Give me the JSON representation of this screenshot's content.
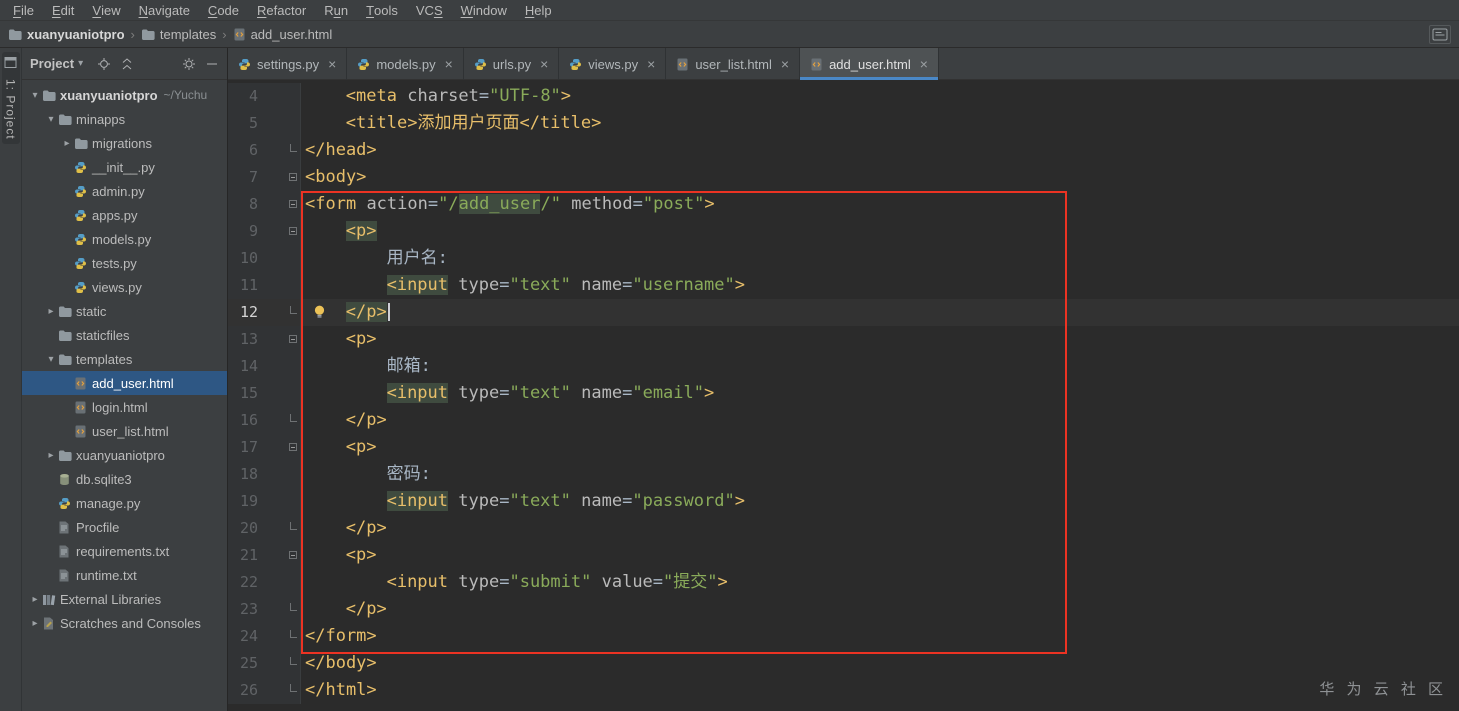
{
  "colors": {
    "accent_blue": "#4a88c7",
    "annotation_red": "#ec3323",
    "tag_yellow": "#e8bf6a",
    "string_green": "#8aab5a",
    "selection_blue": "#2e5784",
    "panel_bg": "#3c3f41",
    "editor_bg": "#2b2b2b",
    "current_line_bg": "#323232"
  },
  "menu": {
    "items": [
      {
        "label": "File",
        "mnemonic": 0
      },
      {
        "label": "Edit",
        "mnemonic": 0
      },
      {
        "label": "View",
        "mnemonic": 0
      },
      {
        "label": "Navigate",
        "mnemonic": 0
      },
      {
        "label": "Code",
        "mnemonic": 0
      },
      {
        "label": "Refactor",
        "mnemonic": 0
      },
      {
        "label": "Run",
        "mnemonic": 1
      },
      {
        "label": "Tools",
        "mnemonic": 0
      },
      {
        "label": "VCS",
        "mnemonic": 2
      },
      {
        "label": "Window",
        "mnemonic": 0
      },
      {
        "label": "Help",
        "mnemonic": 0
      }
    ]
  },
  "breadcrumb": {
    "items": [
      {
        "label": "xuanyuaniotpro",
        "icon": "folder"
      },
      {
        "label": "templates",
        "icon": "folder"
      },
      {
        "label": "add_user.html",
        "icon": "html"
      }
    ]
  },
  "stripe": {
    "label": "1: Project"
  },
  "project_panel": {
    "title": "Project",
    "tree": [
      {
        "label": "xuanyuaniotpro",
        "suffix": "~/Yuchu",
        "depth": 0,
        "icon": "folder",
        "arrow": "down",
        "bold": true
      },
      {
        "label": "minapps",
        "depth": 1,
        "icon": "folder",
        "arrow": "down"
      },
      {
        "label": "migrations",
        "depth": 2,
        "icon": "folder",
        "arrow": "right"
      },
      {
        "label": "__init__.py",
        "depth": 2,
        "icon": "python"
      },
      {
        "label": "admin.py",
        "depth": 2,
        "icon": "python"
      },
      {
        "label": "apps.py",
        "depth": 2,
        "icon": "python"
      },
      {
        "label": "models.py",
        "depth": 2,
        "icon": "python"
      },
      {
        "label": "tests.py",
        "depth": 2,
        "icon": "python"
      },
      {
        "label": "views.py",
        "depth": 2,
        "icon": "python"
      },
      {
        "label": "static",
        "depth": 1,
        "icon": "folder",
        "arrow": "right"
      },
      {
        "label": "staticfiles",
        "depth": 1,
        "icon": "folder"
      },
      {
        "label": "templates",
        "depth": 1,
        "icon": "folder",
        "arrow": "down"
      },
      {
        "label": "add_user.html",
        "depth": 2,
        "icon": "html",
        "selected": true
      },
      {
        "label": "login.html",
        "depth": 2,
        "icon": "html"
      },
      {
        "label": "user_list.html",
        "depth": 2,
        "icon": "html"
      },
      {
        "label": "xuanyuaniotpro",
        "depth": 1,
        "icon": "folder",
        "arrow": "right"
      },
      {
        "label": "db.sqlite3",
        "depth": 1,
        "icon": "db"
      },
      {
        "label": "manage.py",
        "depth": 1,
        "icon": "python"
      },
      {
        "label": "Procfile",
        "depth": 1,
        "icon": "text"
      },
      {
        "label": "requirements.txt",
        "depth": 1,
        "icon": "text"
      },
      {
        "label": "runtime.txt",
        "depth": 1,
        "icon": "text"
      },
      {
        "label": "External Libraries",
        "depth": 0,
        "icon": "lib",
        "arrow": "right"
      },
      {
        "label": "Scratches and Consoles",
        "depth": 0,
        "icon": "scratch",
        "arrow": "right"
      }
    ]
  },
  "tabs": [
    {
      "label": "settings.py",
      "icon": "python"
    },
    {
      "label": "models.py",
      "icon": "python"
    },
    {
      "label": "urls.py",
      "icon": "python"
    },
    {
      "label": "views.py",
      "icon": "python"
    },
    {
      "label": "user_list.html",
      "icon": "html"
    },
    {
      "label": "add_user.html",
      "icon": "html",
      "active": true
    }
  ],
  "editor": {
    "lines": [
      {
        "num": 4,
        "indent": 4,
        "segs": [
          [
            "<meta",
            "tag"
          ],
          [
            " ",
            ""
          ],
          [
            "charset",
            "attr"
          ],
          [
            "=",
            ""
          ],
          [
            "\"UTF-8\"",
            "str"
          ],
          [
            ">",
            "tag"
          ]
        ]
      },
      {
        "num": 5,
        "indent": 4,
        "segs": [
          [
            "<title>",
            "tag"
          ],
          [
            "添加用户页面",
            "ttl"
          ],
          [
            "</title>",
            "tag"
          ]
        ]
      },
      {
        "num": 6,
        "indent": 0,
        "fold": "end",
        "segs": [
          [
            "</head>",
            "tag"
          ]
        ]
      },
      {
        "num": 7,
        "indent": 0,
        "fold": "start",
        "segs": [
          [
            "<body>",
            "tag"
          ]
        ]
      },
      {
        "num": 8,
        "indent": 0,
        "fold": "start",
        "segs": [
          [
            "<form",
            "tag"
          ],
          [
            " ",
            ""
          ],
          [
            "action",
            "attr"
          ],
          [
            "=",
            ""
          ],
          [
            "\"/",
            "str"
          ],
          [
            "add_user",
            "str hl"
          ],
          [
            "/\"",
            "str"
          ],
          [
            " ",
            ""
          ],
          [
            "method",
            "attr"
          ],
          [
            "=",
            ""
          ],
          [
            "\"post\"",
            "str"
          ],
          [
            ">",
            "tag"
          ]
        ]
      },
      {
        "num": 9,
        "indent": 4,
        "fold": "start",
        "segs": [
          [
            "<p>",
            "tag hl"
          ]
        ]
      },
      {
        "num": 10,
        "indent": 8,
        "segs": [
          [
            "用户名:",
            "txt"
          ]
        ]
      },
      {
        "num": 11,
        "indent": 8,
        "segs": [
          [
            "<input",
            "tag hl"
          ],
          [
            " ",
            ""
          ],
          [
            "type",
            "attr"
          ],
          [
            "=",
            ""
          ],
          [
            "\"text\"",
            "str"
          ],
          [
            " ",
            ""
          ],
          [
            "name",
            "attr"
          ],
          [
            "=",
            ""
          ],
          [
            "\"username\"",
            "str"
          ],
          [
            ">",
            "tag"
          ]
        ]
      },
      {
        "num": 12,
        "indent": 4,
        "fold": "end",
        "current": true,
        "bulb": true,
        "caret": true,
        "segs": [
          [
            "</p>",
            "tag hl"
          ]
        ]
      },
      {
        "num": 13,
        "indent": 4,
        "fold": "start",
        "segs": [
          [
            "<p>",
            "tag"
          ]
        ]
      },
      {
        "num": 14,
        "indent": 8,
        "segs": [
          [
            "邮箱:",
            "txt"
          ]
        ]
      },
      {
        "num": 15,
        "indent": 8,
        "segs": [
          [
            "<input",
            "tag hl"
          ],
          [
            " ",
            ""
          ],
          [
            "type",
            "attr"
          ],
          [
            "=",
            ""
          ],
          [
            "\"text\"",
            "str"
          ],
          [
            " ",
            ""
          ],
          [
            "name",
            "attr"
          ],
          [
            "=",
            ""
          ],
          [
            "\"email\"",
            "str"
          ],
          [
            ">",
            "tag"
          ]
        ]
      },
      {
        "num": 16,
        "indent": 4,
        "fold": "end",
        "segs": [
          [
            "</p>",
            "tag"
          ]
        ]
      },
      {
        "num": 17,
        "indent": 4,
        "fold": "start",
        "segs": [
          [
            "<p>",
            "tag"
          ]
        ]
      },
      {
        "num": 18,
        "indent": 8,
        "segs": [
          [
            "密码:",
            "txt"
          ]
        ]
      },
      {
        "num": 19,
        "indent": 8,
        "segs": [
          [
            "<input",
            "tag hl"
          ],
          [
            " ",
            ""
          ],
          [
            "type",
            "attr"
          ],
          [
            "=",
            ""
          ],
          [
            "\"text\"",
            "str"
          ],
          [
            " ",
            ""
          ],
          [
            "name",
            "attr"
          ],
          [
            "=",
            ""
          ],
          [
            "\"password\"",
            "str"
          ],
          [
            ">",
            "tag"
          ]
        ]
      },
      {
        "num": 20,
        "indent": 4,
        "fold": "end",
        "segs": [
          [
            "</p>",
            "tag"
          ]
        ]
      },
      {
        "num": 21,
        "indent": 4,
        "fold": "start",
        "segs": [
          [
            "<p>",
            "tag"
          ]
        ]
      },
      {
        "num": 22,
        "indent": 8,
        "segs": [
          [
            "<input",
            "tag"
          ],
          [
            " ",
            ""
          ],
          [
            "type",
            "attr"
          ],
          [
            "=",
            ""
          ],
          [
            "\"submit\"",
            "str"
          ],
          [
            " ",
            ""
          ],
          [
            "value",
            "attr"
          ],
          [
            "=",
            ""
          ],
          [
            "\"提交\"",
            "str"
          ],
          [
            ">",
            "tag"
          ]
        ]
      },
      {
        "num": 23,
        "indent": 4,
        "fold": "end",
        "segs": [
          [
            "</p>",
            "tag"
          ]
        ]
      },
      {
        "num": 24,
        "indent": 0,
        "fold": "end",
        "segs": [
          [
            "</form>",
            "tag"
          ]
        ]
      },
      {
        "num": 25,
        "indent": 0,
        "fold": "end",
        "segs": [
          [
            "</body>",
            "tag"
          ]
        ]
      },
      {
        "num": 26,
        "indent": 0,
        "fold": "end",
        "segs": [
          [
            "</html>",
            "tag"
          ]
        ]
      }
    ]
  },
  "watermark": "华 为 云 社 区"
}
